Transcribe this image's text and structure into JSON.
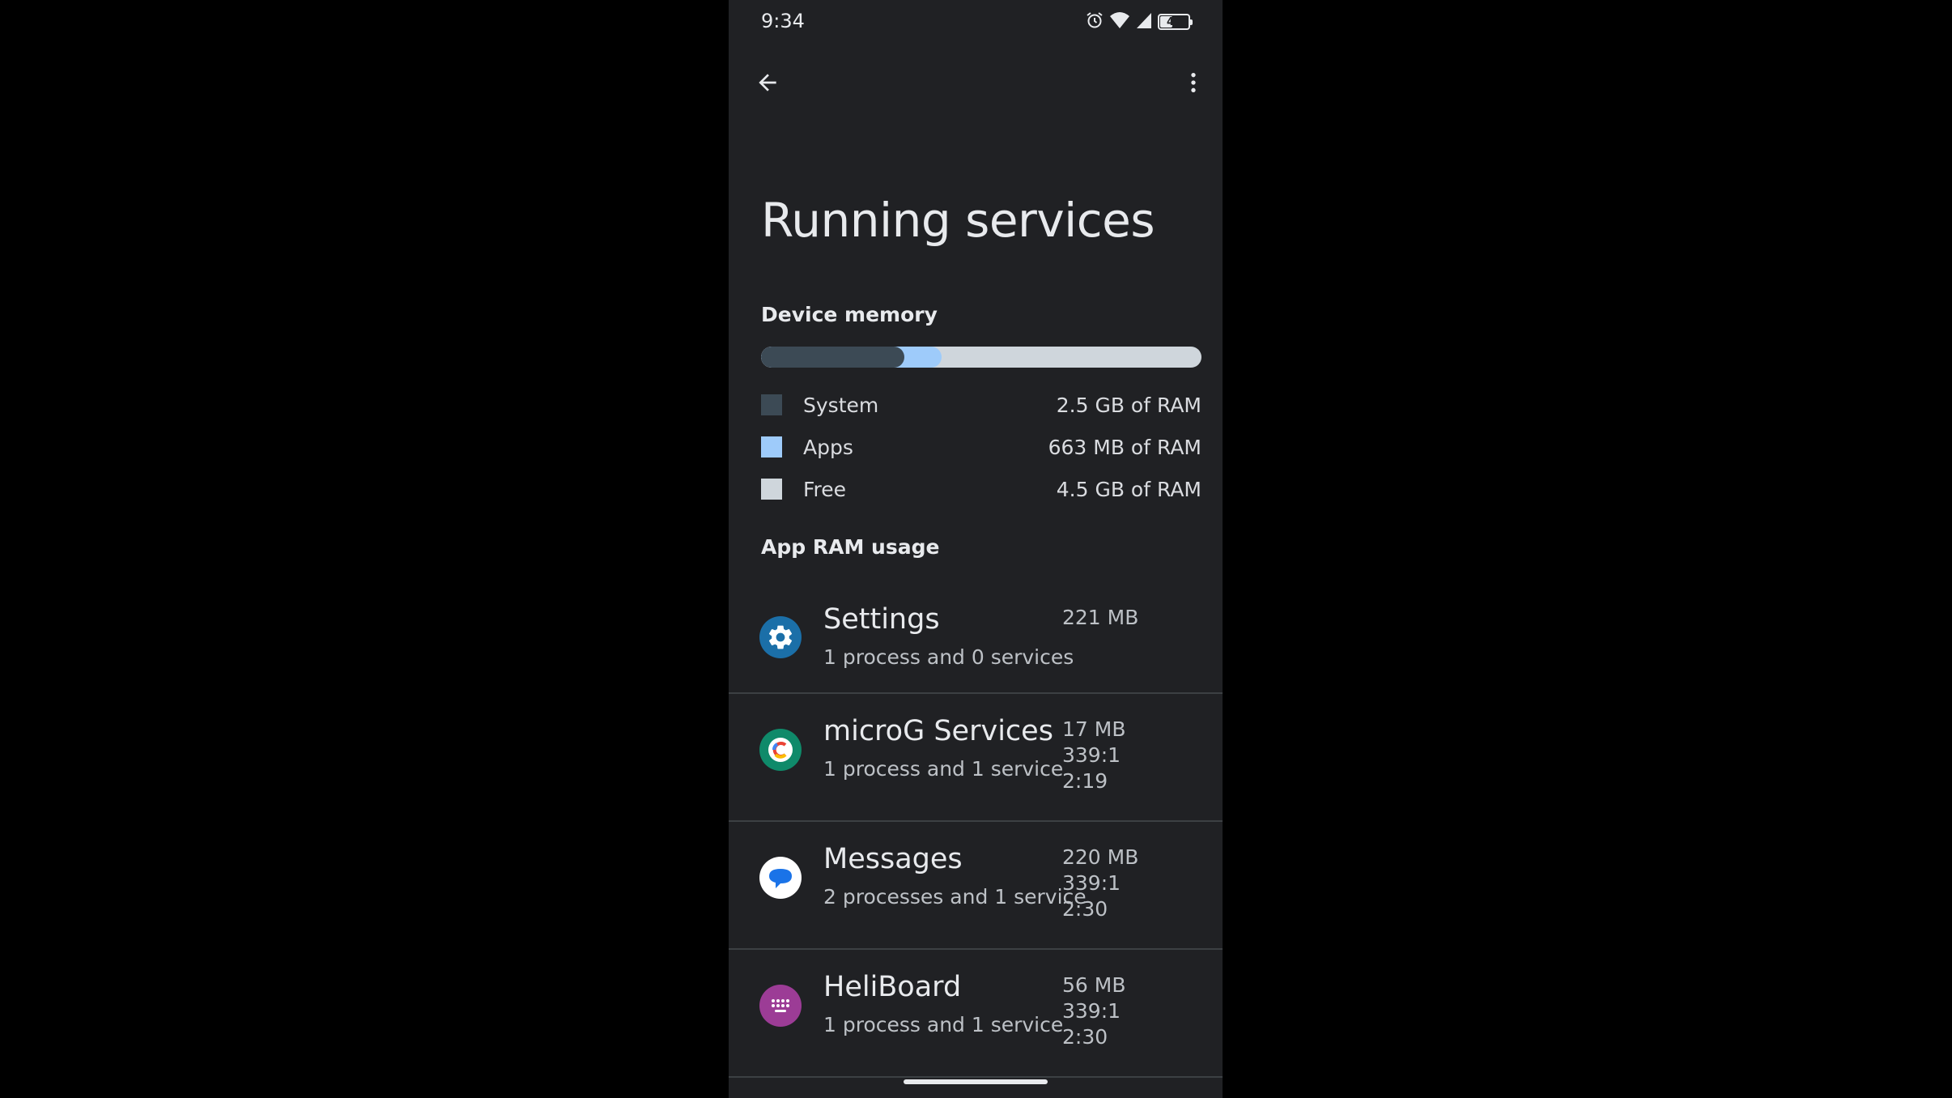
{
  "status_bar": {
    "time": "9:34",
    "battery_level": "43",
    "icons": [
      "alarm-icon",
      "wifi-icon",
      "signal-icon",
      "battery-icon"
    ]
  },
  "app_bar": {
    "back_icon": "arrow-back-icon",
    "menu_icon": "more-vert-icon"
  },
  "page": {
    "title": "Running services"
  },
  "device_memory": {
    "header": "Device memory",
    "colors": {
      "system": "#3c4a55",
      "apps": "#9ecbfa",
      "free": "#cfd6dc"
    },
    "usage_fraction": {
      "system": 0.325,
      "apps": 0.085
    },
    "legend": [
      {
        "key": "system",
        "label": "System",
        "value": "2.5 GB of RAM"
      },
      {
        "key": "apps",
        "label": "Apps",
        "value": "663 MB of RAM"
      },
      {
        "key": "free",
        "label": "Free",
        "value": "4.5 GB of RAM"
      }
    ]
  },
  "app_ram_usage": {
    "header": "App RAM usage",
    "apps": [
      {
        "name": "Settings",
        "detail": "1 process and 0 services",
        "size": "221 MB",
        "time": "",
        "icon": "settings-gear-icon"
      },
      {
        "name": "microG Services",
        "detail": "1 process and 1 service",
        "size": "17 MB",
        "time": "339:12:19",
        "icon": "microg-icon"
      },
      {
        "name": "Messages",
        "detail": "2 processes and 1 service",
        "size": "220 MB",
        "time": "339:12:30",
        "icon": "messages-icon"
      },
      {
        "name": "HeliBoard",
        "detail": "1 process and 1 service",
        "size": "56 MB",
        "time": "339:12:30",
        "icon": "keyboard-icon"
      }
    ]
  }
}
